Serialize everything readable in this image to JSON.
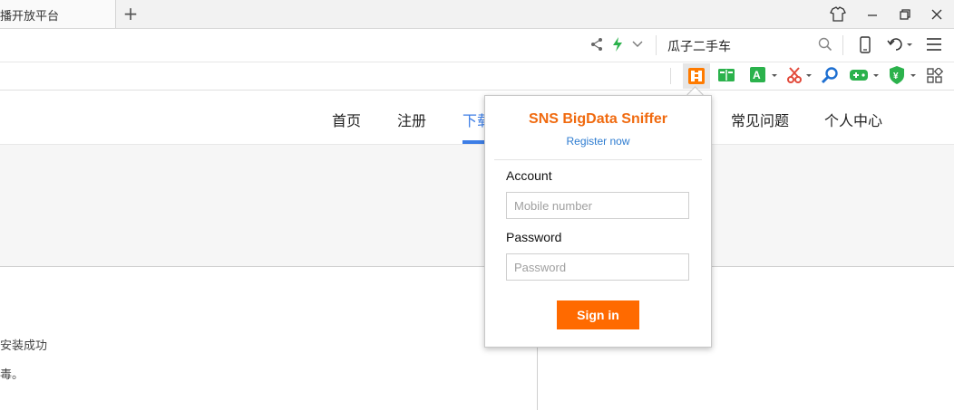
{
  "browser": {
    "tab_title": "播开放平台",
    "new_tab_glyph": "+",
    "search_text": "瓜子二手车"
  },
  "page": {
    "nav": [
      "首页",
      "注册",
      "下载",
      "常见问题",
      "个人中心"
    ],
    "body_line_1": "安装成功",
    "body_line_2": "毒。"
  },
  "popup": {
    "title": "SNS BigData Sniffer",
    "register_link": "Register now",
    "account_label": "Account",
    "account_placeholder": "Mobile number",
    "password_label": "Password",
    "password_placeholder": "Password",
    "signin_label": "Sign in"
  },
  "icons": [
    "shirt-icon",
    "minimize-icon",
    "restore-icon",
    "close-icon",
    "share-icon",
    "lightning-icon",
    "chevron-down-icon",
    "search-icon",
    "phone-icon",
    "undo-icon",
    "menu-icon",
    "sniffer-extension-icon",
    "book-icon",
    "translate-icon",
    "scissors-icon",
    "magnifier-icon",
    "gamepad-icon",
    "shield-icon",
    "apps-icon"
  ],
  "colors": {
    "accent_orange": "#ff6a00",
    "title_orange": "#f06a0f",
    "link_blue": "#2c7bd0",
    "nav_underline": "#3d7ee6"
  }
}
